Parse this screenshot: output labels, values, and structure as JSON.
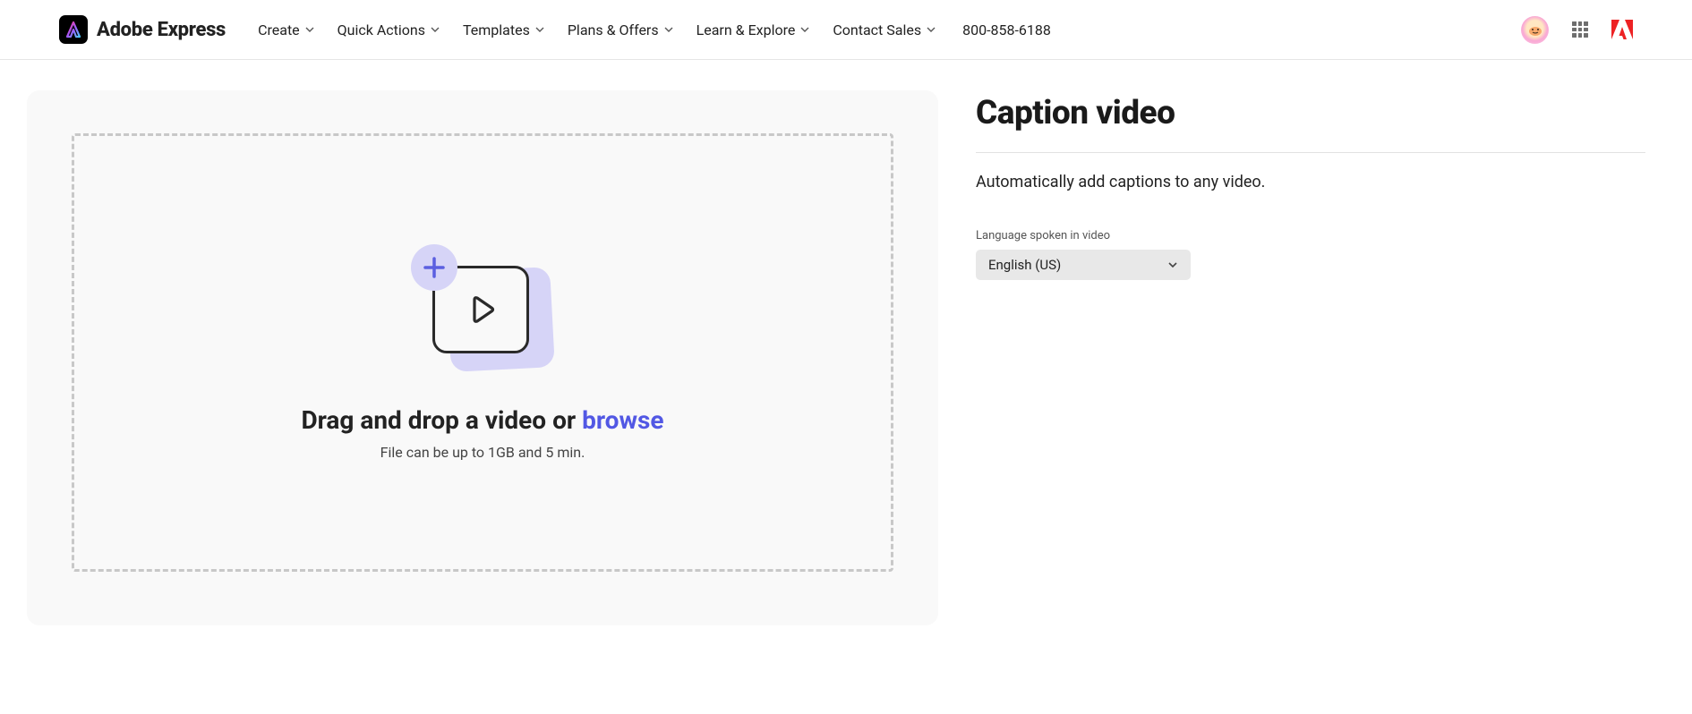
{
  "header": {
    "brand": "Adobe Express",
    "nav": [
      {
        "label": "Create"
      },
      {
        "label": "Quick Actions"
      },
      {
        "label": "Templates"
      },
      {
        "label": "Plans & Offers"
      },
      {
        "label": "Learn & Explore"
      },
      {
        "label": "Contact Sales"
      }
    ],
    "phone": "800-858-6188"
  },
  "dropzone": {
    "primary_prefix": "Drag and drop a video or ",
    "primary_action": "browse",
    "secondary": "File can be up to 1GB and 5 min."
  },
  "panel": {
    "title": "Caption video",
    "subtitle": "Automatically add captions to any video.",
    "language_label": "Language spoken in video",
    "language_value": "English (US)"
  }
}
